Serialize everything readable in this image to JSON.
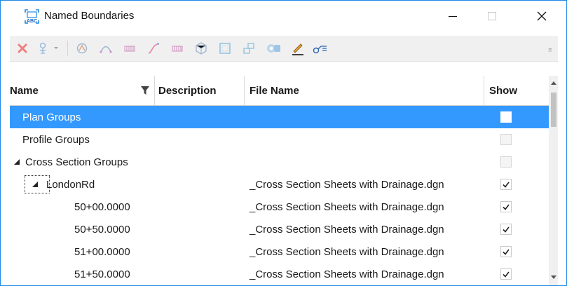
{
  "window": {
    "title": "Named Boundaries",
    "title_icon": "named-boundaries-icon",
    "accent": "#1e88e5"
  },
  "toolbar": {
    "tools": [
      {
        "name": "delete-icon"
      },
      {
        "name": "place-boundary-icon"
      },
      {
        "name": "civil-icon"
      },
      {
        "name": "arc-icon"
      },
      {
        "name": "table-icon"
      },
      {
        "name": "profile-icon"
      },
      {
        "name": "table-2-icon"
      },
      {
        "name": "model-icon"
      },
      {
        "name": "boundary-icon"
      },
      {
        "name": "group-icon"
      },
      {
        "name": "view-icon"
      },
      {
        "name": "edit-pencil-icon"
      },
      {
        "name": "key-settings-icon"
      }
    ]
  },
  "table": {
    "columns": {
      "name": "Name",
      "description": "Description",
      "file_name": "File Name",
      "show": "Show"
    },
    "rows": [
      {
        "name": "Plan Groups",
        "file": "",
        "level": 0,
        "expander": "",
        "checked": false,
        "enabled": true,
        "selected": true
      },
      {
        "name": "Profile Groups",
        "file": "",
        "level": 0,
        "expander": "",
        "checked": false,
        "enabled": false,
        "selected": false
      },
      {
        "name": "Cross Section Groups",
        "file": "",
        "level": 0,
        "expander": "◢",
        "checked": false,
        "enabled": false,
        "selected": false
      },
      {
        "name": "LondonRd",
        "file": "_Cross Section Sheets with Drainage.dgn",
        "level": 1,
        "expander": "◢",
        "checked": true,
        "enabled": true,
        "selected": false
      },
      {
        "name": "50+00.0000",
        "file": "_Cross Section Sheets with Drainage.dgn",
        "level": 2,
        "expander": "",
        "checked": true,
        "enabled": true,
        "selected": false
      },
      {
        "name": "50+50.0000",
        "file": "_Cross Section Sheets with Drainage.dgn",
        "level": 2,
        "expander": "",
        "checked": true,
        "enabled": true,
        "selected": false
      },
      {
        "name": "51+00.0000",
        "file": "_Cross Section Sheets with Drainage.dgn",
        "level": 2,
        "expander": "",
        "checked": true,
        "enabled": true,
        "selected": false
      },
      {
        "name": "51+50.0000",
        "file": "_Cross Section Sheets with Drainage.dgn",
        "level": 2,
        "expander": "",
        "checked": true,
        "enabled": true,
        "selected": false
      }
    ],
    "selected_color": "#3399ff"
  }
}
